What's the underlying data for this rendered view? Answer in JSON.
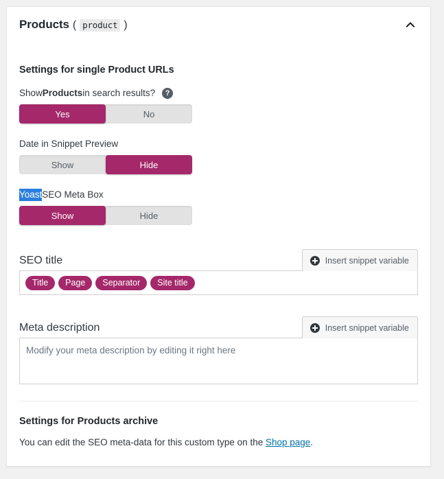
{
  "panel": {
    "title": "Products",
    "open_paren": "(",
    "post_type": "product",
    "close_paren": ")",
    "collapse_icon": "chevron-up-icon"
  },
  "single_settings": {
    "heading": "Settings for single Product URLs",
    "search_results": {
      "label_prefix": "Show ",
      "label_strong": "Products",
      "label_suffix": " in search results?",
      "help_glyph": "?",
      "options": [
        "Yes",
        "No"
      ],
      "selected": "Yes"
    },
    "date_snippet": {
      "label": "Date in Snippet Preview",
      "options": [
        "Show",
        "Hide"
      ],
      "selected": "Hide"
    },
    "meta_box": {
      "label_selected": "Yoast",
      "label_rest": " SEO Meta Box",
      "options": [
        "Show",
        "Hide"
      ],
      "selected": "Show"
    }
  },
  "seo_title": {
    "label": "SEO title",
    "insert_button": "Insert snippet variable",
    "variables": [
      "Title",
      "Page",
      "Separator",
      "Site title"
    ]
  },
  "meta_description": {
    "label": "Meta description",
    "insert_button": "Insert snippet variable",
    "value": "Modify your meta description by editing it right here"
  },
  "archive_settings": {
    "heading": "Settings for Products archive",
    "text_before": "You can edit the SEO meta-data for this custom type on the ",
    "link_text": "Shop page",
    "text_after": "."
  },
  "colors": {
    "accent": "#a4286a",
    "link": "#0073aa",
    "selection": "#2a7fe0",
    "toggle_track": "#e2e2e2"
  }
}
